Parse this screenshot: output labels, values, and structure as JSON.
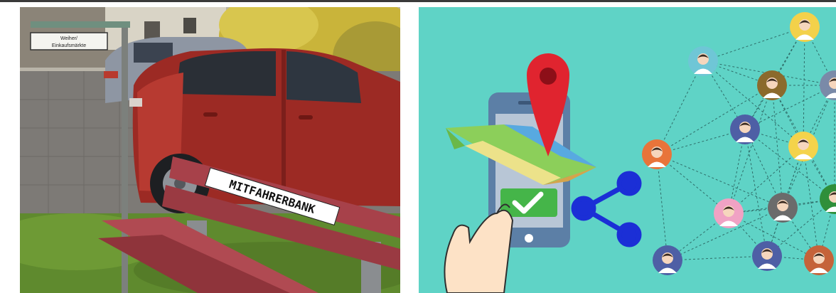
{
  "left_photo": {
    "street_sign": {
      "line1": "Weiher/",
      "line2": "Einkaufsmärkte"
    },
    "bench_sign": "MITFAHRERBANK"
  },
  "right_illustration": {
    "colors": {
      "background": "#5fd3c6",
      "phone_body": "#5c7fa6",
      "map_pin": "#e0242f",
      "check_button": "#45b549",
      "share_icon": "#1b2fd6"
    }
  }
}
